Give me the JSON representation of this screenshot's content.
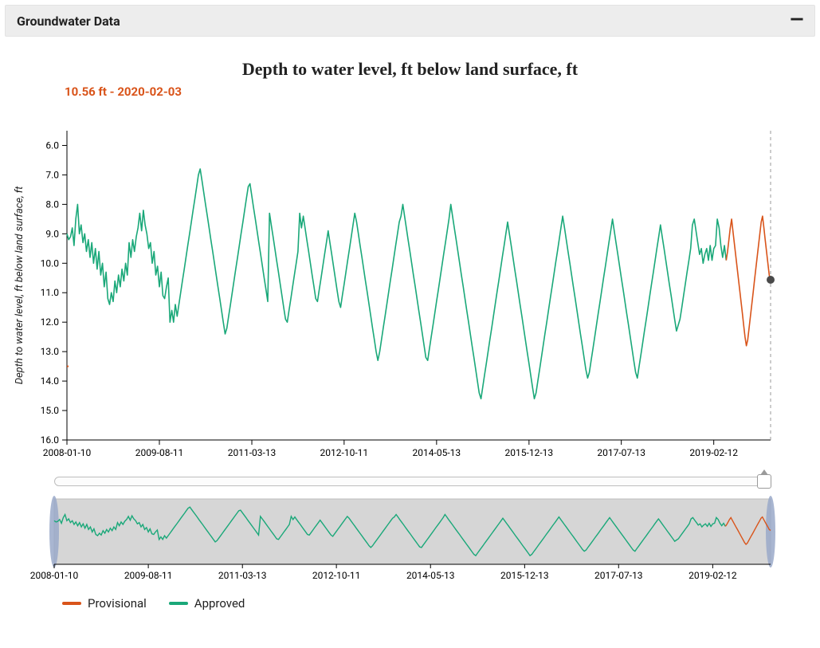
{
  "header": {
    "title": "Groundwater Data",
    "collapse_glyph": "—"
  },
  "readout": {
    "value": "10.56 ft",
    "date": "2020-02-03",
    "sep": " - "
  },
  "legend": [
    {
      "name": "Provisional",
      "color": "#d9541a"
    },
    {
      "name": "Approved",
      "color": "#1aa879"
    }
  ],
  "chart_data": {
    "type": "line",
    "title": "Depth to water level, ft below land surface, ft",
    "ylabel": "Depth to water level, ft below land surface, ft",
    "xlabel": "",
    "x_ticks": [
      "2008-01-10",
      "2009-08-11",
      "2011-03-13",
      "2012-10-11",
      "2014-05-13",
      "2015-12-13",
      "2017-07-13",
      "2019-02-12"
    ],
    "y_ticks": [
      6.0,
      7.0,
      8.0,
      9.0,
      10.0,
      11.0,
      12.0,
      13.0,
      14.0,
      15.0,
      16.0
    ],
    "ylim": [
      16.0,
      5.5
    ],
    "y_inverted": true,
    "x_domain_dates": [
      "2008-01-10",
      "2020-02-03"
    ],
    "hover_point": {
      "date": "2020-02-03",
      "value": 10.56,
      "series": "Provisional"
    },
    "approved_range_dates": [
      "2008-01-10",
      "2019-05-01"
    ],
    "provisional_range_dates": [
      "2019-05-01",
      "2020-02-03"
    ],
    "initial_segment": {
      "range_dates": [
        "2008-01-10",
        "2008-01-20"
      ],
      "color": "#d9541a",
      "value": 13.5
    },
    "series": [
      {
        "name": "Approved",
        "color": "#1aa879",
        "values": [
          9.0,
          9.2,
          9.1,
          8.8,
          9.4,
          8.5,
          8.0,
          9.0,
          8.7,
          9.3,
          9.0,
          9.6,
          9.2,
          9.8,
          9.3,
          10.0,
          9.5,
          10.2,
          9.6,
          10.4,
          10.0,
          10.8,
          10.3,
          11.2,
          11.4,
          11.0,
          11.3,
          10.6,
          11.0,
          10.4,
          10.8,
          10.2,
          10.6,
          10.0,
          10.4,
          9.3,
          9.8,
          9.2,
          9.6,
          9.1,
          8.8,
          8.3,
          8.9,
          8.2,
          8.7,
          9.0,
          9.5,
          9.3,
          10.0,
          9.6,
          10.4,
          10.1,
          10.8,
          10.3,
          11.1,
          11.2,
          10.8,
          10.5,
          12.0,
          11.6,
          12.0,
          11.4,
          11.8,
          11.4,
          11.0,
          10.6,
          10.2,
          9.8,
          9.4,
          9.0,
          8.6,
          8.2,
          7.8,
          7.4,
          7.0,
          6.8,
          7.2,
          7.6,
          8.0,
          8.4,
          8.8,
          9.2,
          9.6,
          10.0,
          10.4,
          10.8,
          11.2,
          11.6,
          12.0,
          12.4,
          12.2,
          11.8,
          11.4,
          11.0,
          10.6,
          10.2,
          9.8,
          9.4,
          9.0,
          8.6,
          8.2,
          7.8,
          7.4,
          7.3,
          7.7,
          8.1,
          8.5,
          8.9,
          9.3,
          9.7,
          10.1,
          10.5,
          10.9,
          11.3,
          8.3,
          8.7,
          9.1,
          9.5,
          9.9,
          10.3,
          10.7,
          11.1,
          11.5,
          11.9,
          12.0,
          11.6,
          11.2,
          10.8,
          10.4,
          10.0,
          9.6,
          8.3,
          8.8,
          8.4,
          8.8,
          9.2,
          9.6,
          10.0,
          10.4,
          10.8,
          11.2,
          11.3,
          10.9,
          10.5,
          10.1,
          9.7,
          9.3,
          8.9,
          9.3,
          9.7,
          10.1,
          10.5,
          10.9,
          11.3,
          11.5,
          11.1,
          10.7,
          10.3,
          9.9,
          9.5,
          9.1,
          8.7,
          8.3,
          8.6,
          9.0,
          9.4,
          9.8,
          10.2,
          10.6,
          11.0,
          11.4,
          11.8,
          12.2,
          12.6,
          13.0,
          13.3,
          13.0,
          12.6,
          12.2,
          11.8,
          11.4,
          11.0,
          10.6,
          10.2,
          9.8,
          9.4,
          9.0,
          8.6,
          8.4,
          8.0,
          8.4,
          8.8,
          9.2,
          9.6,
          10.0,
          10.4,
          10.8,
          11.2,
          11.6,
          12.0,
          12.4,
          12.8,
          13.2,
          13.3,
          12.9,
          12.5,
          12.1,
          11.7,
          11.3,
          10.9,
          10.5,
          10.1,
          9.7,
          9.3,
          8.9,
          8.5,
          8.0,
          8.4,
          8.8,
          9.2,
          9.6,
          10.0,
          10.4,
          10.8,
          11.2,
          11.6,
          12.0,
          12.4,
          12.8,
          13.2,
          13.6,
          14.0,
          14.4,
          14.6,
          14.2,
          13.8,
          13.4,
          13.0,
          12.6,
          12.2,
          11.8,
          11.4,
          11.0,
          10.6,
          10.2,
          9.8,
          9.4,
          9.0,
          8.6,
          9.0,
          9.4,
          9.8,
          10.2,
          10.6,
          11.0,
          11.4,
          11.8,
          12.2,
          12.6,
          13.0,
          13.4,
          13.8,
          14.2,
          14.6,
          14.4,
          14.0,
          13.6,
          13.2,
          12.8,
          12.4,
          12.0,
          11.6,
          11.2,
          10.8,
          10.4,
          10.0,
          9.6,
          9.2,
          8.8,
          8.4,
          8.8,
          9.2,
          9.6,
          10.0,
          10.4,
          10.8,
          11.2,
          11.6,
          12.0,
          12.4,
          12.8,
          13.2,
          13.6,
          13.9,
          13.7,
          13.3,
          12.9,
          12.5,
          12.1,
          11.7,
          11.3,
          10.9,
          10.5,
          10.1,
          9.7,
          9.3,
          8.9,
          8.5,
          8.9,
          9.3,
          9.7,
          10.1,
          10.5,
          10.9,
          11.3,
          11.7,
          12.1,
          12.5,
          12.9,
          13.3,
          13.7,
          13.9,
          13.5,
          13.1,
          12.7,
          12.3,
          11.9,
          11.5,
          11.1,
          10.7,
          10.3,
          9.9,
          9.5,
          9.1,
          8.7,
          9.1,
          9.5,
          9.9,
          10.3,
          10.7,
          11.1,
          11.5,
          11.9,
          12.3,
          12.1,
          11.9,
          11.5,
          11.1,
          10.7,
          10.3,
          9.9,
          9.5,
          8.7,
          8.5,
          8.9,
          9.3,
          9.7,
          9.5,
          10.0,
          9.7,
          9.5,
          9.9,
          9.4,
          9.9,
          9.5,
          9.4,
          8.5,
          8.8,
          9.4,
          9.8,
          9.4,
          9.9
        ]
      },
      {
        "name": "Provisional",
        "color": "#d9541a",
        "values": [
          9.9,
          9.6,
          9.2,
          8.8,
          8.5,
          8.9,
          9.3,
          9.7,
          10.1,
          10.5,
          10.9,
          11.3,
          11.7,
          12.1,
          12.5,
          12.8,
          12.6,
          12.2,
          11.8,
          11.4,
          11.0,
          10.6,
          10.2,
          9.8,
          9.4,
          9.0,
          8.6,
          8.4,
          8.8,
          9.2,
          9.6,
          10.0,
          10.4,
          10.56
        ]
      }
    ]
  }
}
